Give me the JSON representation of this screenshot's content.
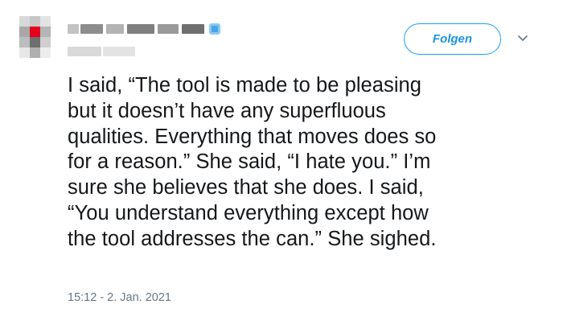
{
  "header": {
    "follow_label": "Folgen",
    "accent_color": "#1da1f2"
  },
  "icons": {
    "verified": "verified-badge-icon",
    "menu": "chevron-down-icon"
  },
  "tweet": {
    "lines": [
      "I said, “The tool is made to be pleasing",
      "but it doesn’t have any superfluous",
      "qualities. Everything that moves does so",
      "for a reason.” She said, “I hate you.” I’m",
      "sure she believes that she does. I said,",
      "“You understand everything except how",
      "the tool addresses the can.” She sighed."
    ],
    "timestamp": "15:12 - 2. Jan. 2021"
  }
}
